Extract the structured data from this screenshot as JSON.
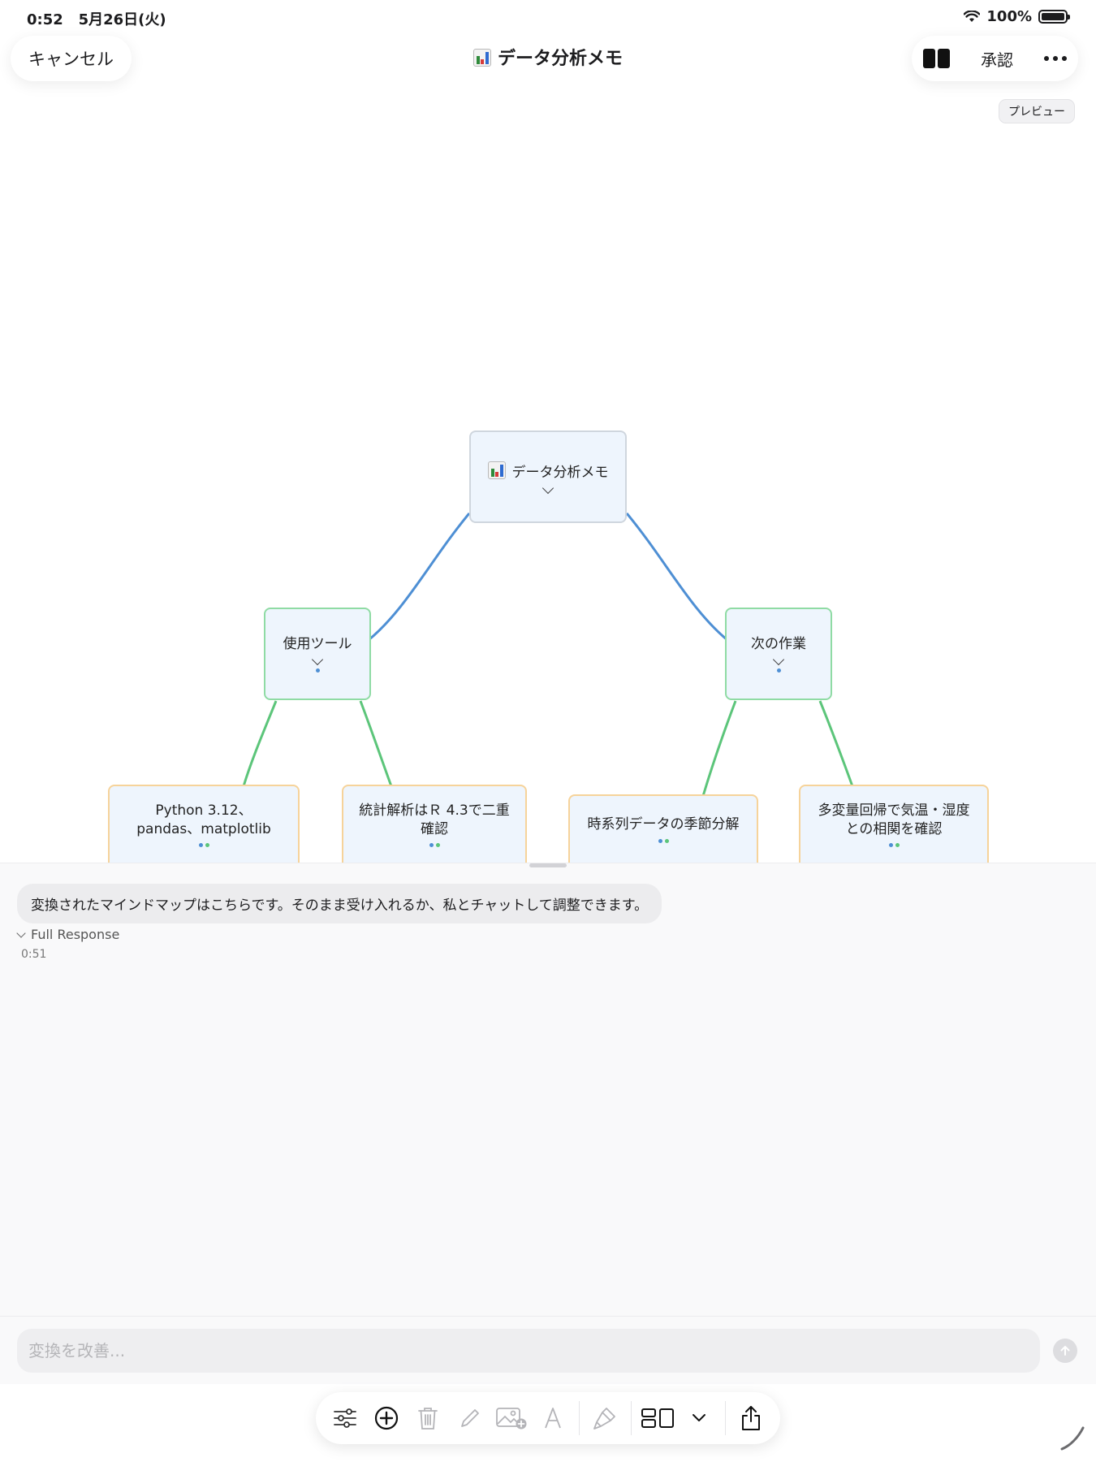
{
  "status_bar": {
    "time": "0:52",
    "date": "5月26日(火)",
    "battery": "100%"
  },
  "nav": {
    "cancel": "キャンセル",
    "title": "データ分析メモ",
    "approve": "承認"
  },
  "preview_badge": "プレビュー",
  "mindmap": {
    "root": "データ分析メモ",
    "branch_left": "使用ツール",
    "branch_right": "次の作業",
    "leaves": [
      "Python 3.12、pandas、matplotlib",
      "統計解析はＲ 4.3で二重確認",
      "時系列データの季節分解",
      "多変量回帰で気温・湿度との相関を確認"
    ],
    "colors": {
      "root_edge": "#4e8fd4",
      "branch_edge": "#5cc57a",
      "leaf_border": "#f6d39a",
      "node_fill": "#eef5fd"
    }
  },
  "chat": {
    "message": "変換されたマインドマップはこちらです。そのまま受け入れるか、私とチャットして調整できます。",
    "full_response": "Full Response",
    "time": "0:51",
    "input_placeholder": "変換を改善..."
  },
  "toolbar": {
    "icons": [
      "sliders-icon",
      "add-circle-icon",
      "trash-icon",
      "pencil-icon",
      "add-image-icon",
      "text-style-icon",
      "paintbrush-icon",
      "layout-icon",
      "chevron-down-icon",
      "share-icon"
    ]
  }
}
